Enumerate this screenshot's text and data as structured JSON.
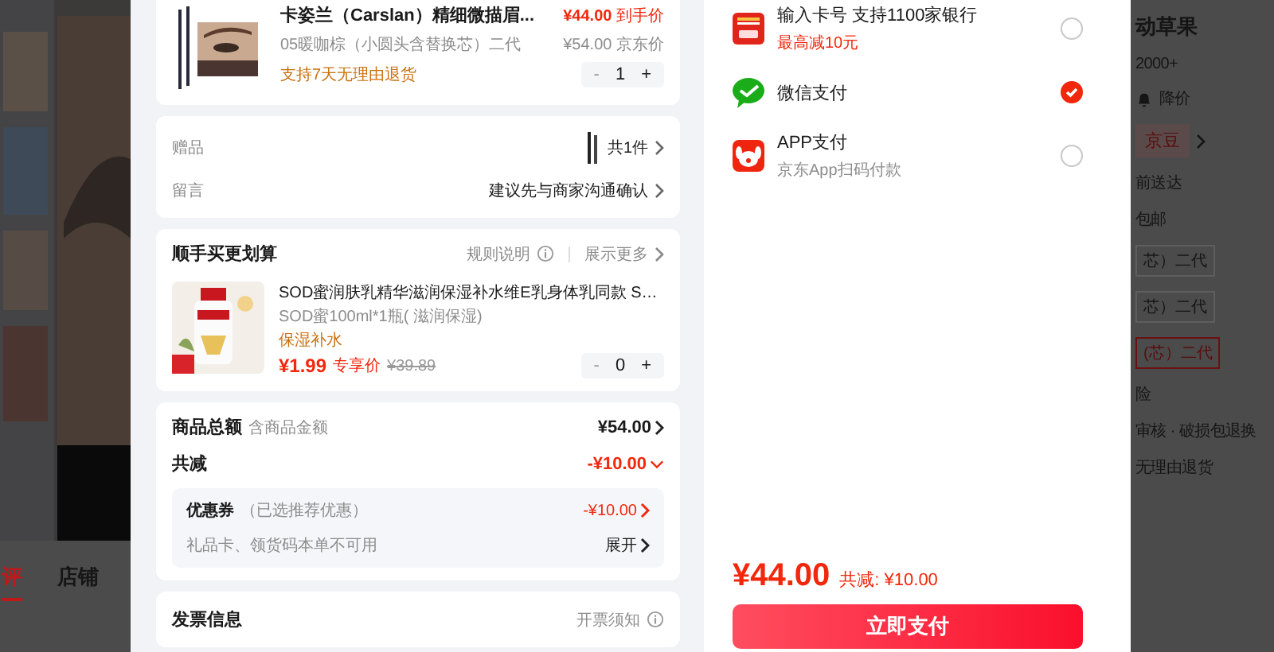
{
  "background": {
    "tabs": [
      {
        "label": "评",
        "selected": true
      },
      {
        "label": "店铺",
        "selected": false
      }
    ],
    "side_texts": [
      {
        "text": "动草果",
        "kind": "title"
      },
      {
        "text": "2000+",
        "kind": "plain"
      },
      {
        "text": "降价",
        "kind": "bell"
      },
      {
        "text": "京豆",
        "kind": "chip"
      },
      {
        "text": "前送达",
        "kind": "plain"
      },
      {
        "text": "包邮",
        "kind": "plain"
      },
      {
        "text": "芯）二代",
        "kind": "option"
      },
      {
        "text": "芯）二代",
        "kind": "option"
      },
      {
        "text": "(芯）二代",
        "kind": "option_selected"
      },
      {
        "text": "险",
        "kind": "plain"
      },
      {
        "text": "审核 · 破损包退换",
        "kind": "plain"
      },
      {
        "text": "无理由退货",
        "kind": "plain"
      }
    ]
  },
  "order": {
    "product": {
      "title": "卡姿兰（Carslan）精细微描眉...",
      "price": "¥44.00",
      "price_tag": "到手价",
      "variant": "05暖咖棕（小圆头含替换芯）二代",
      "jd_price": "¥54.00",
      "jd_tag": "京东价",
      "returns": "支持7天无理由退货",
      "quantity": "1",
      "minus": "-",
      "plus": "+"
    },
    "gift": {
      "label": "赠品",
      "count": "共1件"
    },
    "message": {
      "label": "留言",
      "value": "建议先与商家沟通确认"
    },
    "addon": {
      "title": "顺手买更划算",
      "rules": "规则说明",
      "more": "展示更多",
      "item": {
        "title": "SOD蜜润肤乳精华滋润保湿补水维E乳身体乳同款 S…",
        "spec": "SOD蜜100ml*1瓶( 滋润保湿)",
        "tag": "保湿补水",
        "price": "¥1.99",
        "price_tag": "专享价",
        "original_price": "¥39.89",
        "quantity": "0",
        "minus": "-",
        "plus": "+"
      }
    },
    "summary": {
      "goods_label": "商品总额",
      "goods_note": "含商品金额",
      "goods_total": "¥54.00",
      "discount_label": "共减",
      "discount_total": "-¥10.00",
      "coupon_label": "优惠券",
      "coupon_note": "（已选推荐优惠）",
      "coupon_value": "-¥10.00",
      "giftcard_note": "礼品卡、领货码本单不可用",
      "expand": "展开"
    },
    "invoice": {
      "title": "发票信息",
      "note": "开票须知"
    }
  },
  "payment": {
    "methods": [
      {
        "kind": "card",
        "title": "输入卡号 支持1100家银行",
        "subtitle": "最高减10元",
        "selected": false
      },
      {
        "kind": "wechat",
        "title": "微信支付",
        "selected": true
      },
      {
        "kind": "app",
        "title": "APP支付",
        "subtitle": "京东App扫码付款",
        "selected": false
      }
    ],
    "total": "¥44.00",
    "saved": "共减: ¥10.00",
    "button": "立即支付"
  }
}
